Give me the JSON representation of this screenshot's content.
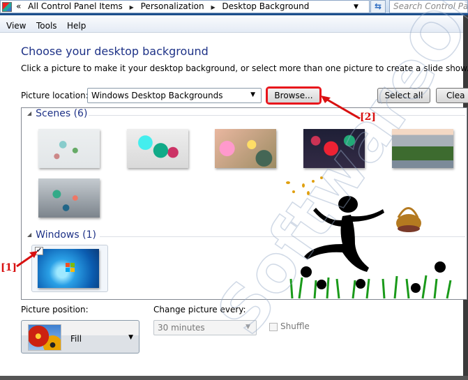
{
  "address_bar": {
    "overflow_glyph": "«",
    "breadcrumbs": [
      "All Control Panel Items",
      "Personalization",
      "Desktop Background"
    ],
    "search_placeholder": "Search Control Panel",
    "search_visible_text": "Search Control Pan"
  },
  "menu": {
    "items": [
      "View",
      "Tools",
      "Help"
    ]
  },
  "page": {
    "title": "Choose your desktop background",
    "subtitle": "Click a picture to make it your desktop background, or select more than one picture to create a slide show.",
    "picture_location_label": "Picture location:",
    "picture_location_value": "Windows Desktop Backgrounds",
    "browse_label": "Browse...",
    "select_all_label": "Select all",
    "clear_all_label": "Clear all",
    "clear_all_visible": "Clea"
  },
  "gallery": {
    "groups": [
      {
        "name": "Scenes (6)",
        "images": [
          "scene-1",
          "scene-2",
          "scene-3",
          "scene-4",
          "scene-5",
          "scene-6"
        ]
      },
      {
        "name": "Windows (1)",
        "images": [
          {
            "id": "windows-7-default",
            "checked": true
          }
        ]
      }
    ]
  },
  "bottom": {
    "picture_position_label": "Picture position:",
    "picture_position_value": "Fill",
    "change_every_label": "Change picture every:",
    "change_every_value": "30 minutes",
    "change_every_enabled": false,
    "shuffle_label": "Shuffle",
    "shuffle_checked": false
  },
  "annotations": {
    "marker1": "[1]",
    "marker2": "[2]",
    "color": "#d81010"
  },
  "watermark": "SoftwareOK.com",
  "colors": {
    "title_blue": "#1e3287",
    "highlight_red": "#e8141b"
  }
}
